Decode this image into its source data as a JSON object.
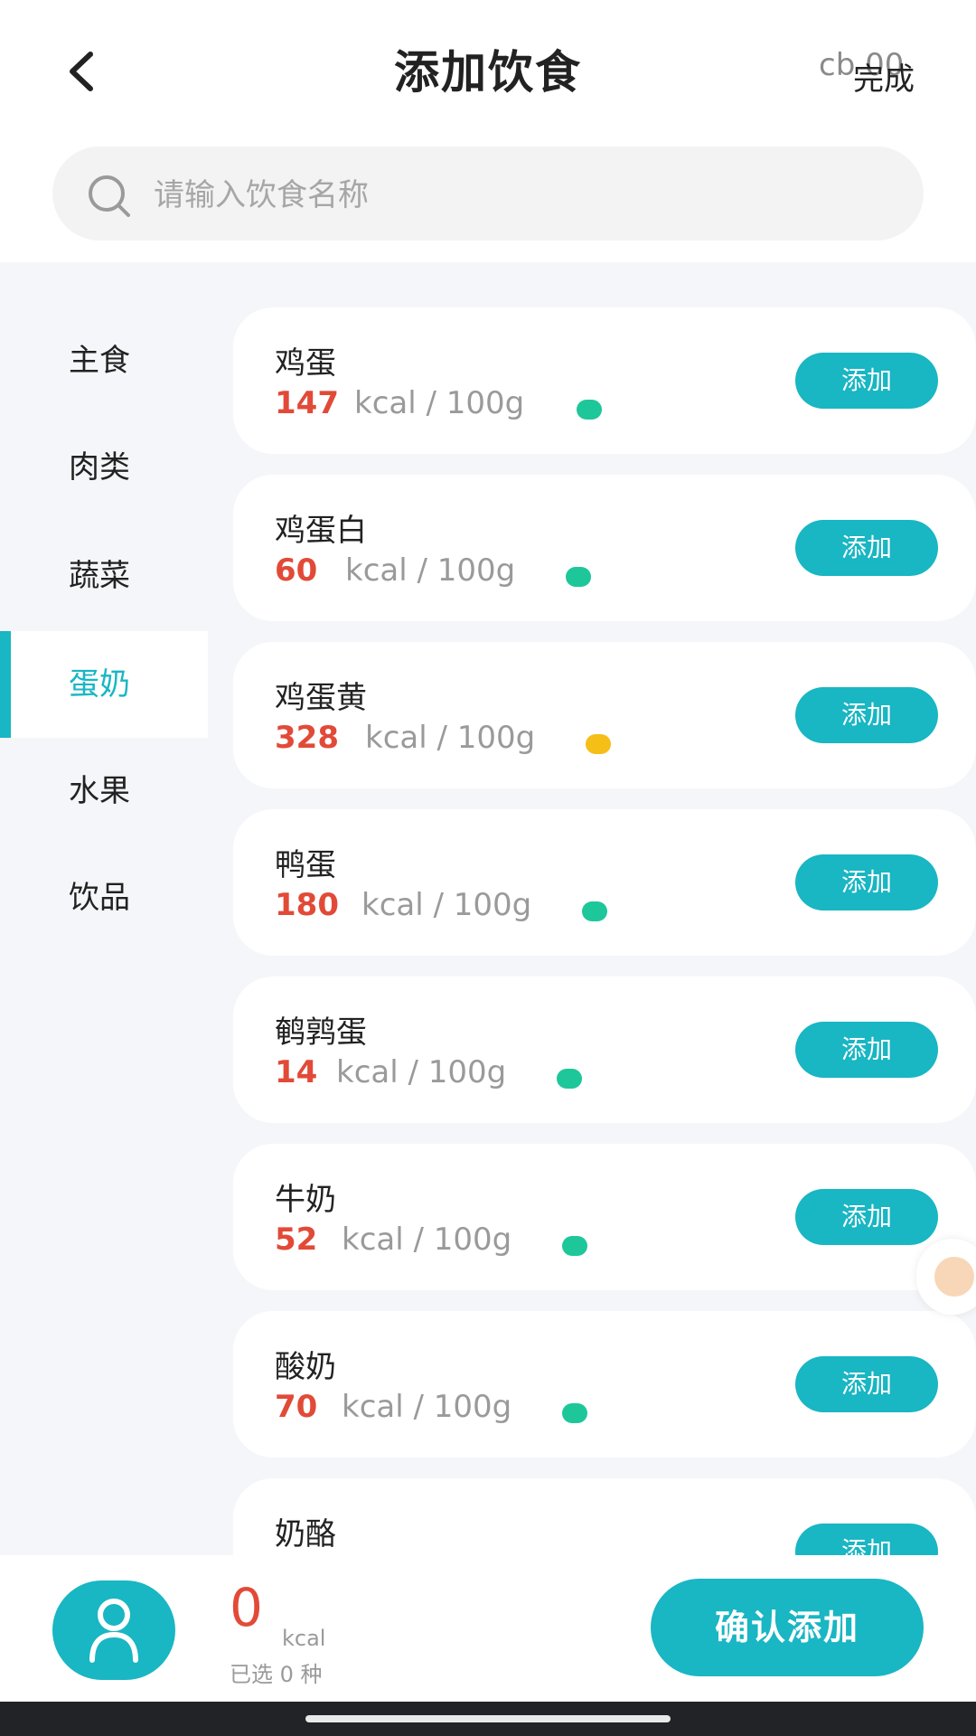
{
  "header": {
    "title": "添加饮食",
    "done_label": "完成",
    "overlay_text": "cb 00"
  },
  "search": {
    "placeholder": "请输入饮食名称"
  },
  "categories": [
    {
      "label": "主食",
      "active": false
    },
    {
      "label": "肉类",
      "active": false
    },
    {
      "label": "蔬菜",
      "active": false
    },
    {
      "label": "蛋奶",
      "active": true
    },
    {
      "label": "水果",
      "active": false
    },
    {
      "label": "饮品",
      "active": false
    }
  ],
  "foods": [
    {
      "name": "鸡蛋",
      "kcal": "147",
      "unit": "kcal / 100g",
      "indicator_color": "#1ec79a",
      "add_label": "添加"
    },
    {
      "name": "鸡蛋白",
      "kcal": "60",
      "unit": "kcal / 100g",
      "indicator_color": "#1ec79a",
      "add_label": "添加"
    },
    {
      "name": "鸡蛋黄",
      "kcal": "328",
      "unit": "kcal / 100g",
      "indicator_color": "#f5bf18",
      "add_label": "添加"
    },
    {
      "name": "鸭蛋",
      "kcal": "180",
      "unit": "kcal / 100g",
      "indicator_color": "#1ec79a",
      "add_label": "添加"
    },
    {
      "name": "鹌鹑蛋",
      "kcal": "14",
      "unit": "kcal / 100g",
      "indicator_color": "#1ec79a",
      "add_label": "添加"
    },
    {
      "name": "牛奶",
      "kcal": "52",
      "unit": "kcal / 100g",
      "indicator_color": "#1ec79a",
      "add_label": "添加"
    },
    {
      "name": "酸奶",
      "kcal": "70",
      "unit": "kcal / 100g",
      "indicator_color": "#1ec79a",
      "add_label": "添加"
    },
    {
      "name": "奶酪",
      "add_label": "添加"
    }
  ],
  "summary": {
    "total_kcal": "0",
    "unit": "kcal",
    "selected_text": "已选 0 种"
  },
  "footer": {
    "confirm_label": "确认添加"
  },
  "colors": {
    "accent": "#19b6c3",
    "calorie": "#e24a38",
    "healthy_dot": "#1ec79a",
    "caution_dot": "#f5bf18"
  }
}
